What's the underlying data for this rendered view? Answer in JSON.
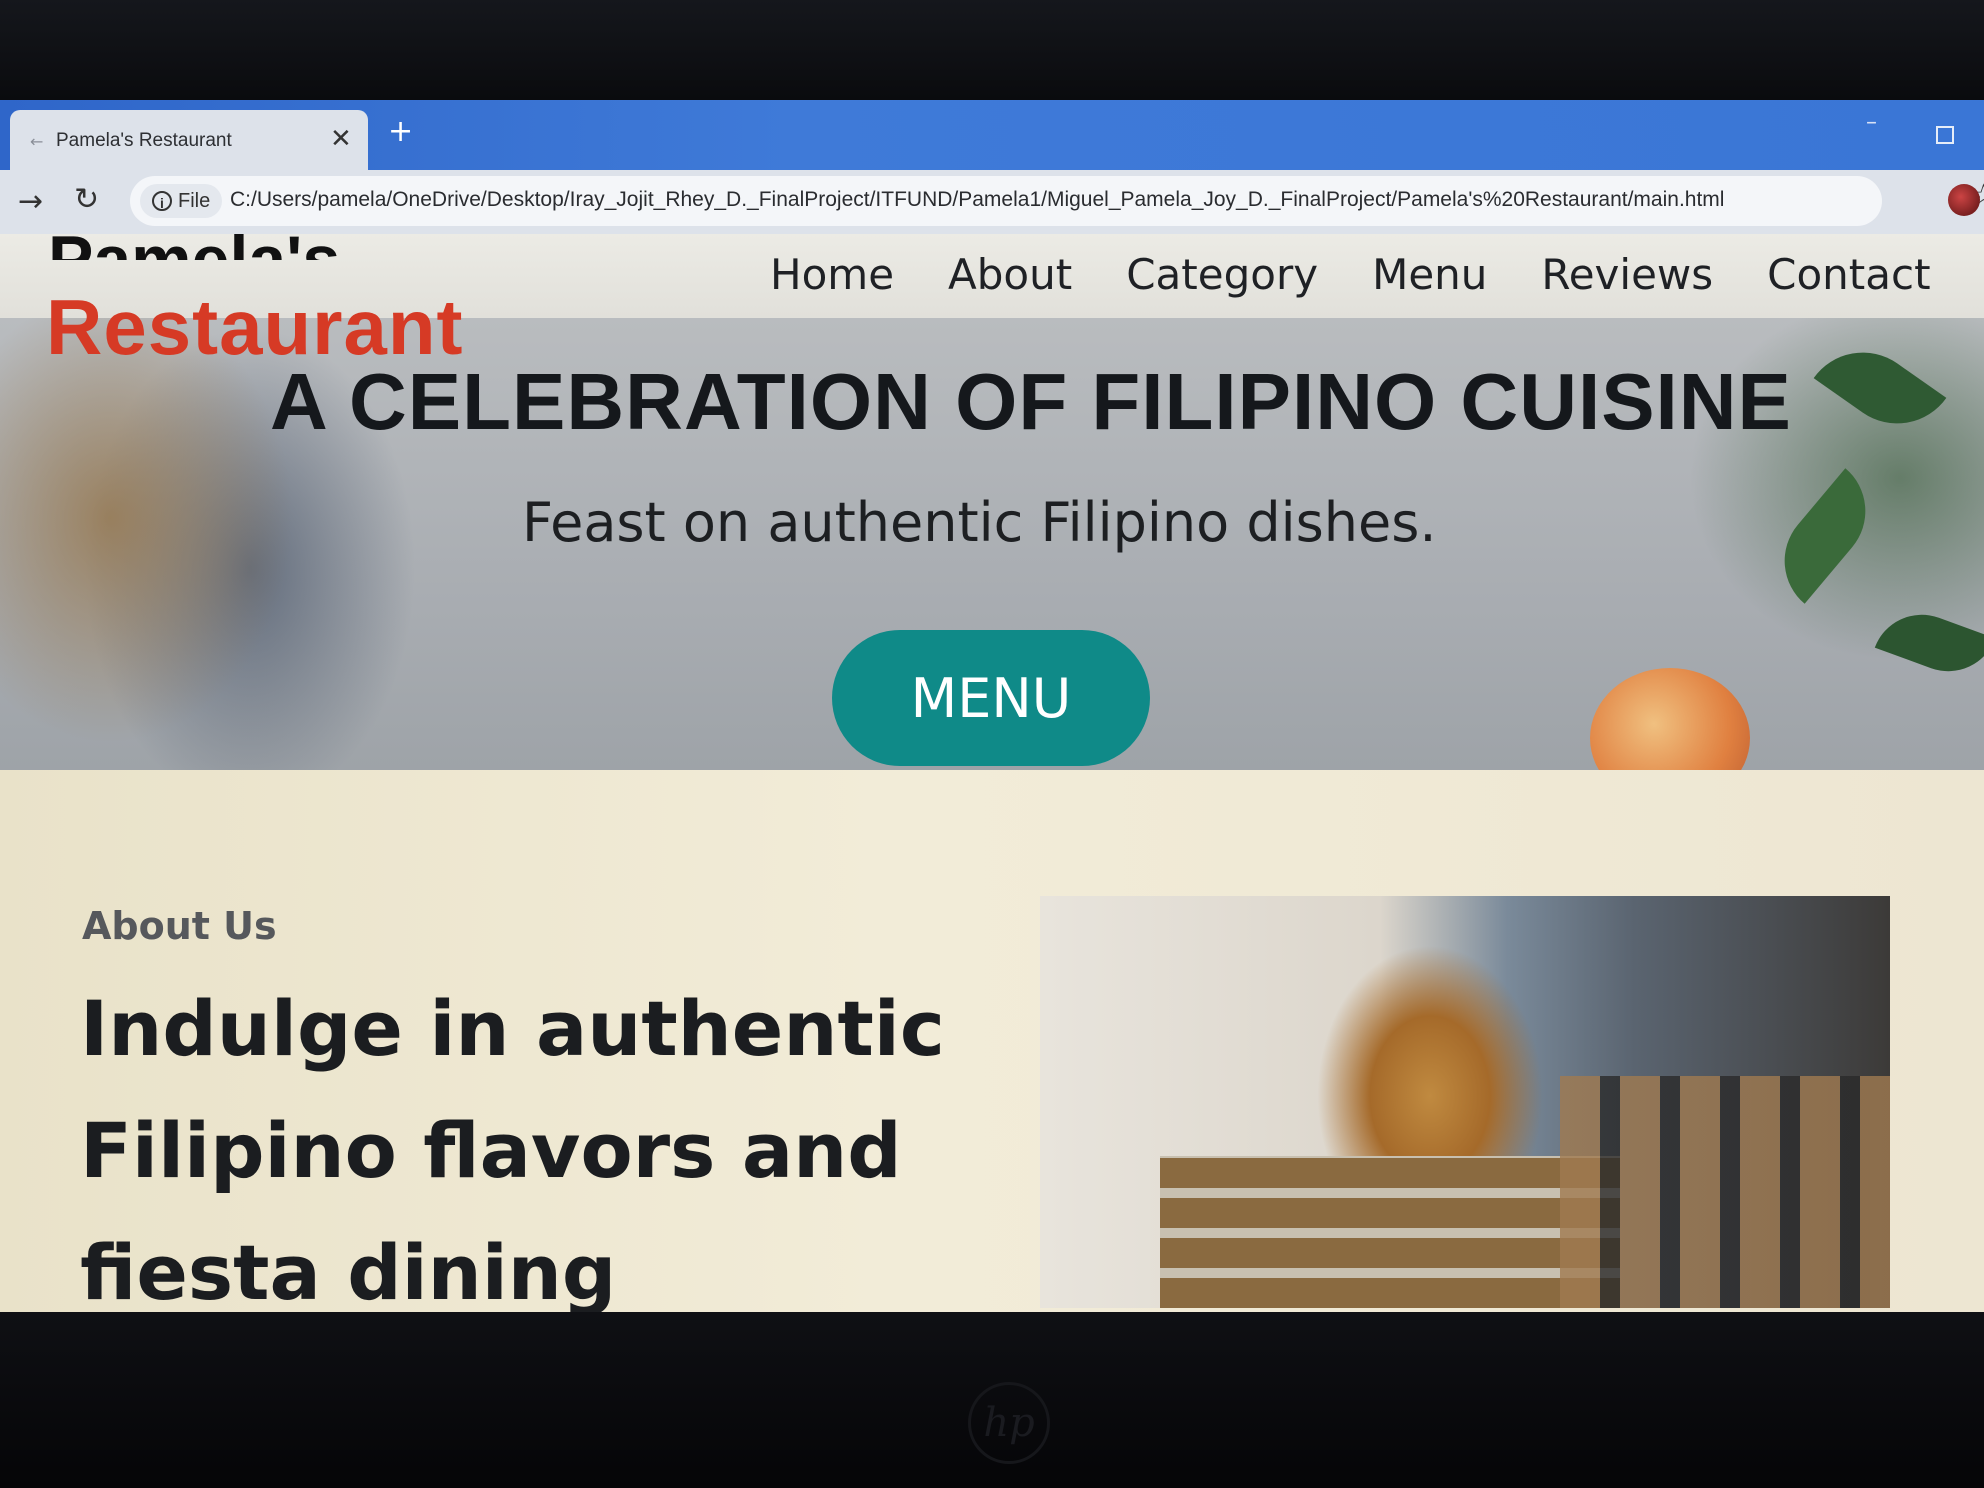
{
  "browser": {
    "tab": {
      "title": "Pamela's Restaurant",
      "close_icon": "close-icon",
      "new_tab_label": "+"
    },
    "toolbar": {
      "security_label": "File",
      "url": "C:/Users/pamela/OneDrive/Desktop/Iray_Jojit_Rhey_D._FinalProject/ITFUND/Pamela1/Miguel_Pamela_Joy_D._FinalProject/Pamela's%20Restaurant/main.html"
    }
  },
  "site": {
    "brand": {
      "name": "Pamela's",
      "subtitle": "Restaurant"
    },
    "nav": [
      "Home",
      "About",
      "Category",
      "Menu",
      "Reviews",
      "Contact"
    ],
    "hero": {
      "title": "A CELEBRATION OF FILIPINO CUISINE",
      "subtitle": "Feast on authentic Filipino dishes.",
      "button_label": "MENU"
    },
    "about": {
      "eyebrow": "About Us",
      "heading": "Indulge in authentic Filipino flavors and fiesta dining"
    }
  },
  "colors": {
    "brand_accent": "#d63a25",
    "button": "#0f8a88",
    "browser_bar": "#3a76d6"
  }
}
